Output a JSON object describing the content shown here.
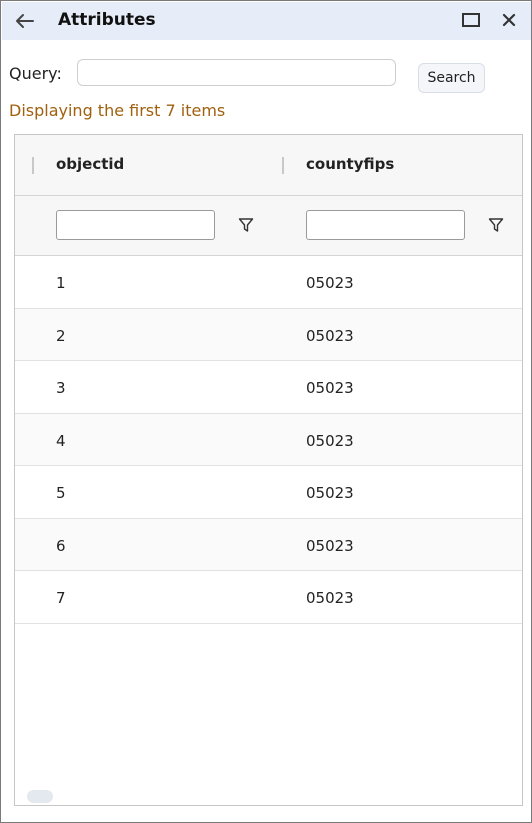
{
  "window": {
    "title": "Attributes",
    "icons": {
      "back": "arrow-left-icon",
      "maximize": "maximize-icon",
      "close": "close-icon",
      "filter": "filter-icon"
    },
    "accent_color": "#e6edf8"
  },
  "query": {
    "label": "Query:",
    "value": "",
    "placeholder": "",
    "search_label": "Search"
  },
  "status": {
    "text": "Displaying the first 7 items",
    "color": "#a0600e"
  },
  "table": {
    "columns": [
      {
        "label": "objectid",
        "filter_value": ""
      },
      {
        "label": "countyfips",
        "filter_value": ""
      }
    ],
    "rows": [
      [
        "1",
        "05023"
      ],
      [
        "2",
        "05023"
      ],
      [
        "3",
        "05023"
      ],
      [
        "4",
        "05023"
      ],
      [
        "5",
        "05023"
      ],
      [
        "6",
        "05023"
      ],
      [
        "7",
        "05023"
      ]
    ]
  }
}
